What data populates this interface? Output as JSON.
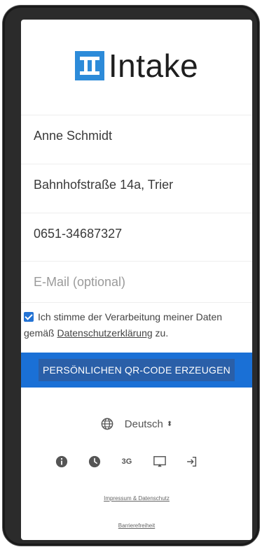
{
  "app": {
    "name": "Intake"
  },
  "form": {
    "name_value": "Anne Schmidt",
    "address_value": "Bahnhofstraße 14a, Trier",
    "phone_value": "0651-34687327",
    "email_value": "",
    "email_placeholder": "E-Mail (optional)"
  },
  "consent": {
    "checked": true,
    "text_before": "Ich stimme der Verarbeitung meiner Daten gemäß ",
    "link": "Datenschutzerklärung",
    "text_after": " zu."
  },
  "cta": {
    "label": "PERSÖNLICHEN QR-CODE ERZEUGEN"
  },
  "language": {
    "selected": "Deutsch"
  },
  "toolbar": {
    "items": [
      {
        "icon": "info-icon"
      },
      {
        "icon": "clock-icon"
      },
      {
        "icon": "network-3g-icon",
        "label": "3G"
      },
      {
        "icon": "cast-screen-icon"
      },
      {
        "icon": "login-icon"
      }
    ]
  },
  "footer": {
    "imprint": "Impressum & Datenschutz",
    "accessibility": "Barrierefreiheit"
  },
  "colors": {
    "primary": "#1a70d6",
    "logo": "#2d8bd9",
    "checkbox": "#2473d4"
  }
}
